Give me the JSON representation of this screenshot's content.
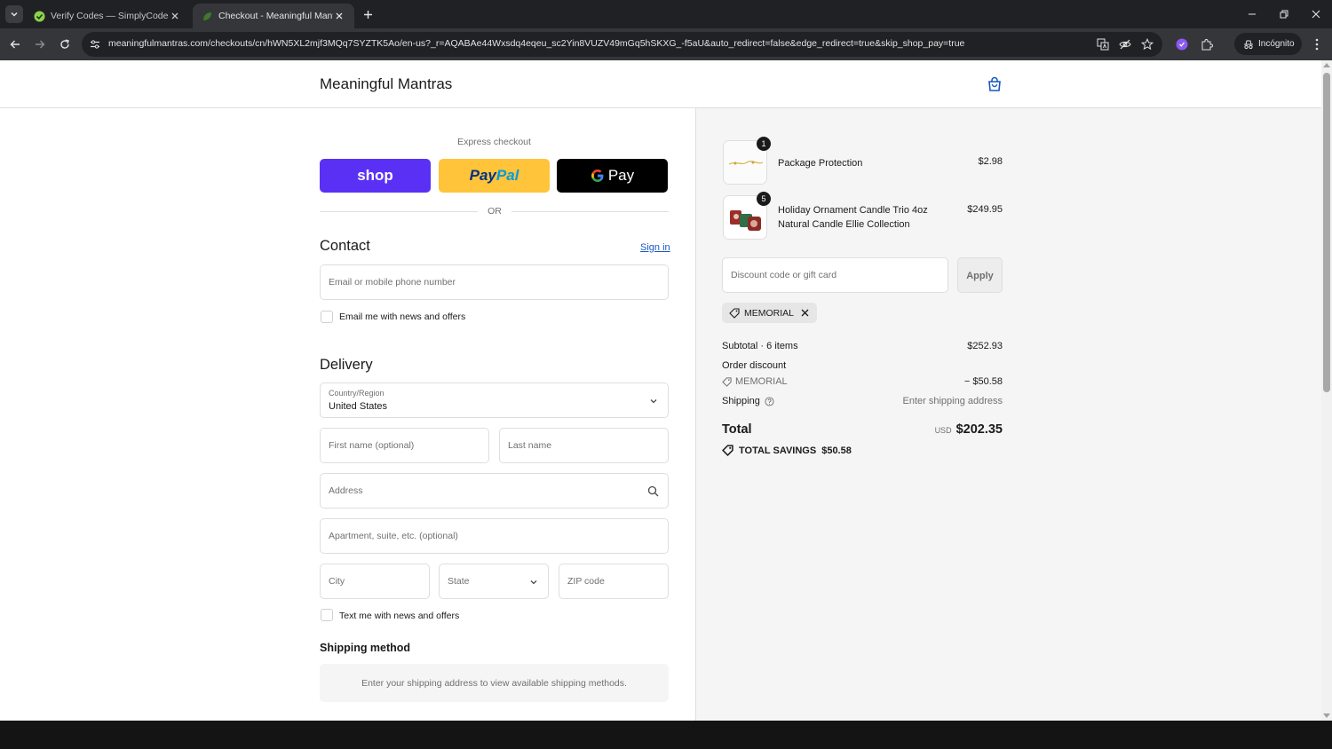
{
  "browser": {
    "tabs": [
      {
        "title": "Verify Codes — SimplyCodes",
        "active": false
      },
      {
        "title": "Checkout - Meaningful Mantras",
        "active": true
      }
    ],
    "url": "meaningfulmantras.com/checkouts/cn/hWN5XL2mjf3MQq7SYZTK5Ao/en-us?_r=AQABAe44Wxsdq4eqeu_sc2Yin8VUZV49mGq5hSKXG_-f5aU&auto_redirect=false&edge_redirect=true&skip_shop_pay=true",
    "incognito_label": "Incógnito"
  },
  "header": {
    "shop_name": "Meaningful Mantras"
  },
  "express": {
    "label": "Express checkout",
    "shop_label": "shop",
    "paypal_label": "PayPal",
    "gpay_label": "Pay",
    "or_label": "OR"
  },
  "contact": {
    "title": "Contact",
    "sign_in": "Sign in",
    "email_placeholder": "Email or mobile phone number",
    "news_checkbox": "Email me with news and offers"
  },
  "delivery": {
    "title": "Delivery",
    "country_label": "Country/Region",
    "country_value": "United States",
    "first_name": "First name (optional)",
    "last_name": "Last name",
    "address": "Address",
    "apartment": "Apartment, suite, etc. (optional)",
    "city": "City",
    "state": "State",
    "zip": "ZIP code",
    "text_checkbox": "Text me with news and offers"
  },
  "shipping_method": {
    "title": "Shipping method",
    "message": "Enter your shipping address to view available shipping methods."
  },
  "summary": {
    "items": [
      {
        "qty": "1",
        "name": "Package Protection",
        "price": "$2.98"
      },
      {
        "qty": "5",
        "name": "Holiday Ornament Candle Trio 4oz Natural Candle Ellie Collection",
        "price": "$249.95"
      }
    ],
    "discount_placeholder": "Discount code or gift card",
    "apply_label": "Apply",
    "applied_code": "MEMORIAL",
    "subtotal_label": "Subtotal · 6 items",
    "subtotal_value": "$252.93",
    "order_discount_label": "Order discount",
    "discount_code": "MEMORIAL",
    "discount_value": "− $50.58",
    "shipping_label": "Shipping",
    "shipping_value": "Enter shipping address",
    "total_label": "Total",
    "currency": "USD",
    "total_value": "$202.35",
    "savings_label": "TOTAL SAVINGS",
    "savings_value": "$50.58"
  },
  "colors": {
    "shop_pay": "#5a31f4",
    "paypal": "#ffc439",
    "link": "#1a57c4"
  }
}
